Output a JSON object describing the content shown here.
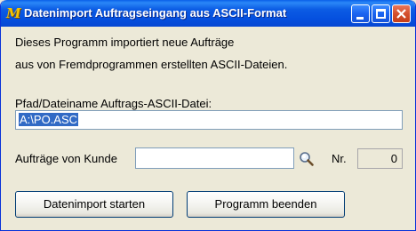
{
  "window": {
    "title": "Datenimport Auftragseingang aus ASCII-Format",
    "icon_letter": "M",
    "accent_color": "#0550df"
  },
  "intro": {
    "line1": "Dieses Programm importiert neue Aufträge",
    "line2": "aus von Fremdprogrammen erstellten ASCII-Dateien."
  },
  "path": {
    "label": "Pfad/Dateiname Auftrags-ASCII-Datei:",
    "value": "A:\\PO.ASC"
  },
  "kunde": {
    "label": "Aufträge von Kunde",
    "value": "",
    "search_icon": "magnifier-icon"
  },
  "nr": {
    "label": "Nr.",
    "value": "0"
  },
  "buttons": {
    "start": "Datenimport starten",
    "end": "Programm beenden"
  }
}
